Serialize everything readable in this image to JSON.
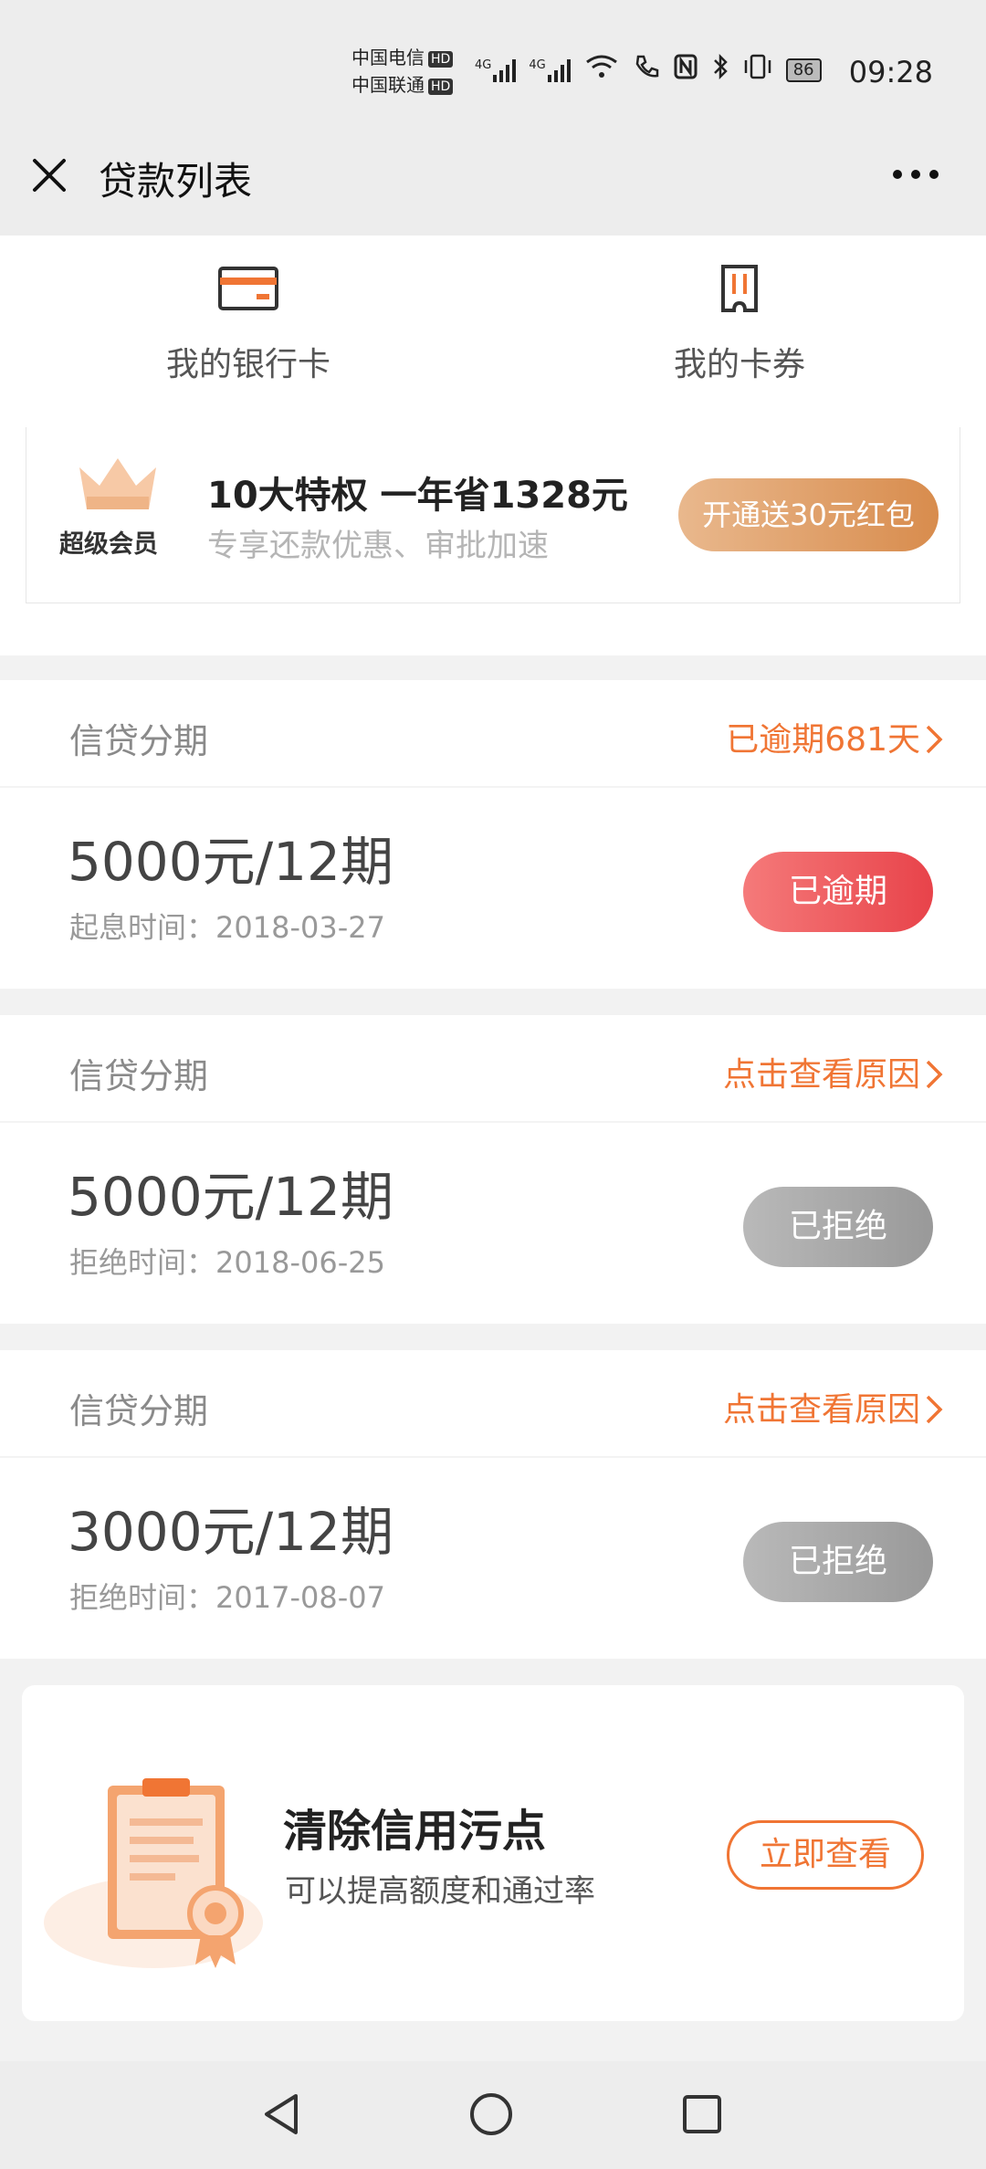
{
  "status_bar": {
    "carrier1": "中国电信",
    "carrier2": "中国联通",
    "hd": "HD",
    "net": "4G",
    "battery": "86",
    "time": "09:28"
  },
  "header": {
    "title": "贷款列表"
  },
  "quick_links": [
    {
      "label": "我的银行卡"
    },
    {
      "label": "我的卡券"
    }
  ],
  "vip": {
    "badge_label": "超级会员",
    "title": "10大特权 一年省1328元",
    "subtitle": "专享还款优惠、审批加速",
    "button": "开通送30元红包"
  },
  "loans": [
    {
      "type": "信贷分期",
      "link": "已逾期681天",
      "amount": "5000元/12期",
      "date": "起息时间：2018-03-27",
      "status": "已逾期"
    },
    {
      "type": "信贷分期",
      "link": "点击查看原因",
      "amount": "5000元/12期",
      "date": "拒绝时间：2018-06-25",
      "status": "已拒绝"
    },
    {
      "type": "信贷分期",
      "link": "点击查看原因",
      "amount": "3000元/12期",
      "date": "拒绝时间：2017-08-07",
      "status": "已拒绝"
    }
  ],
  "credit_banner": {
    "title": "清除信用污点",
    "subtitle": "可以提高额度和通过率",
    "button": "立即查看"
  },
  "colors": {
    "accent": "#f07534",
    "overdue": "#e8434a",
    "rejected": "#a9a9a9",
    "vip_gold": "#d88c4d"
  }
}
